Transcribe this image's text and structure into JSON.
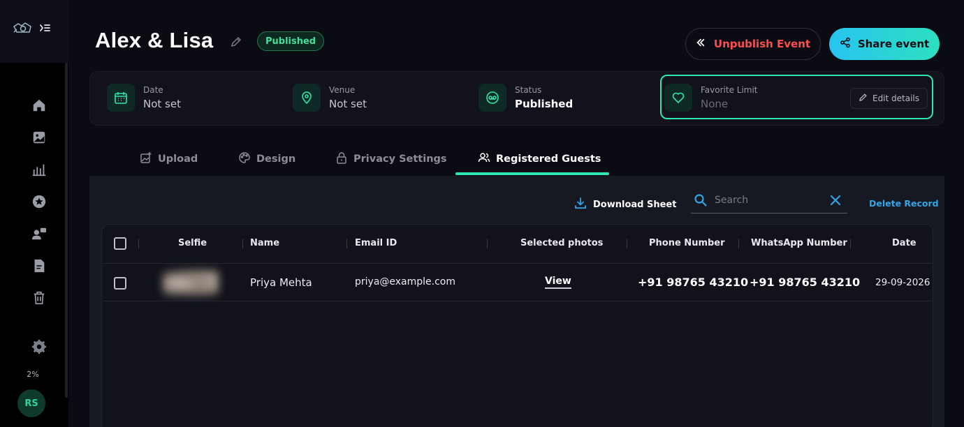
{
  "sidebar": {
    "storage_percent": "2%",
    "avatar_initials": "RS"
  },
  "header": {
    "event_title": "Alex & Lisa",
    "status_badge": "Published",
    "unpublish_label": "Unpublish Event",
    "share_label": "Share event"
  },
  "info": {
    "date": {
      "label": "Date",
      "value": "Not set"
    },
    "venue": {
      "label": "Venue",
      "value": "Not set"
    },
    "status": {
      "label": "Status",
      "value": "Published"
    },
    "favorite": {
      "label": "Favorite Limit",
      "value": "None"
    },
    "edit_label": "Edit details"
  },
  "tabs": [
    {
      "label": "Upload",
      "active": false
    },
    {
      "label": "Design",
      "active": false
    },
    {
      "label": "Privacy Settings",
      "active": false
    },
    {
      "label": "Registered Guests",
      "active": true
    }
  ],
  "toolbar": {
    "download_label": "Download Sheet",
    "search_placeholder": "Search",
    "delete_label": "Delete Record"
  },
  "table": {
    "columns": [
      "Selfie",
      "Name",
      "Email ID",
      "Selected photos",
      "Phone Number",
      "WhatsApp Number",
      "Date"
    ],
    "rows": [
      {
        "name": "Priya Mehta",
        "email": "priya@example.com",
        "selected_photos": "View",
        "phone": "+91 98765 43210",
        "whatsapp": "+91 98765 43210",
        "date": "29-09-2026"
      }
    ]
  },
  "colors": {
    "accent": "#2ee6b0",
    "danger": "#ff4d4d",
    "link": "#2fa6e8"
  }
}
